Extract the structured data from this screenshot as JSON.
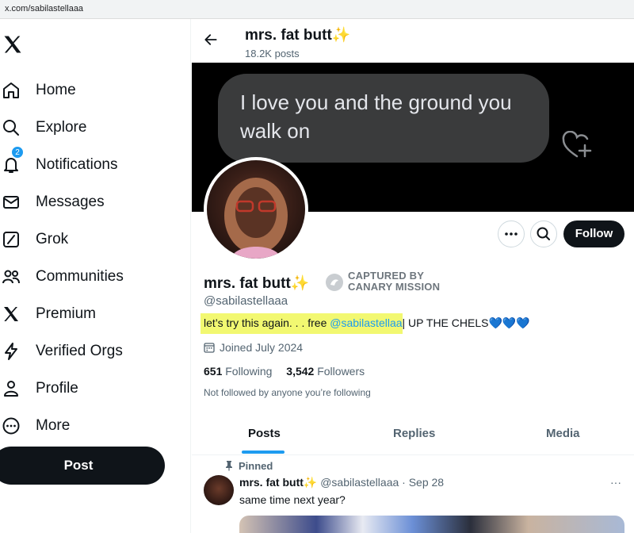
{
  "browser": {
    "url": "x.com/sabilastellaaa"
  },
  "sidebar": {
    "items": [
      {
        "label": "Home",
        "icon": "home-icon"
      },
      {
        "label": "Explore",
        "icon": "search-icon"
      },
      {
        "label": "Notifications",
        "icon": "bell-icon",
        "badge": "2"
      },
      {
        "label": "Messages",
        "icon": "envelope-icon"
      },
      {
        "label": "Grok",
        "icon": "grok-icon"
      },
      {
        "label": "Communities",
        "icon": "people-icon"
      },
      {
        "label": "Premium",
        "icon": "x-logo-icon"
      },
      {
        "label": "Verified Orgs",
        "icon": "lightning-icon"
      },
      {
        "label": "Profile",
        "icon": "person-icon"
      },
      {
        "label": "More",
        "icon": "more-circle-icon"
      }
    ],
    "post_label": "Post"
  },
  "header": {
    "name": "mrs. fat butt✨",
    "posts_count": "18.2K posts"
  },
  "banner": {
    "message": "I love you and the ground you walk on"
  },
  "profile": {
    "follow_label": "Follow",
    "name": "mrs. fat butt✨",
    "canary_line1": "CAPTURED BY",
    "canary_line2": "CANARY MISSION",
    "handle": "@sabilastellaaa",
    "bio_prefix": "let’s try this again. . . free ",
    "bio_mention": "@sabilastellaa",
    "bio_suffix": "| UP THE CHELS💙💙💙",
    "joined": "Joined July 2024",
    "following_count": "651",
    "following_label": "Following",
    "followers_count": "3,542",
    "followers_label": "Followers",
    "not_followed": "Not followed by anyone you’re following"
  },
  "tabs": [
    {
      "label": "Posts",
      "active": true
    },
    {
      "label": "Replies",
      "active": false
    },
    {
      "label": "Media",
      "active": false
    }
  ],
  "pinned_tweet": {
    "pinned_label": "Pinned",
    "name": "mrs. fat butt✨",
    "meta": "@sabilastellaaa · Sep 28",
    "more": "···",
    "text": "same time next year?"
  },
  "colors": {
    "accent": "#1d9bf0",
    "dark": "#0f1419",
    "muted": "#536471",
    "highlight": "#f2f871"
  }
}
